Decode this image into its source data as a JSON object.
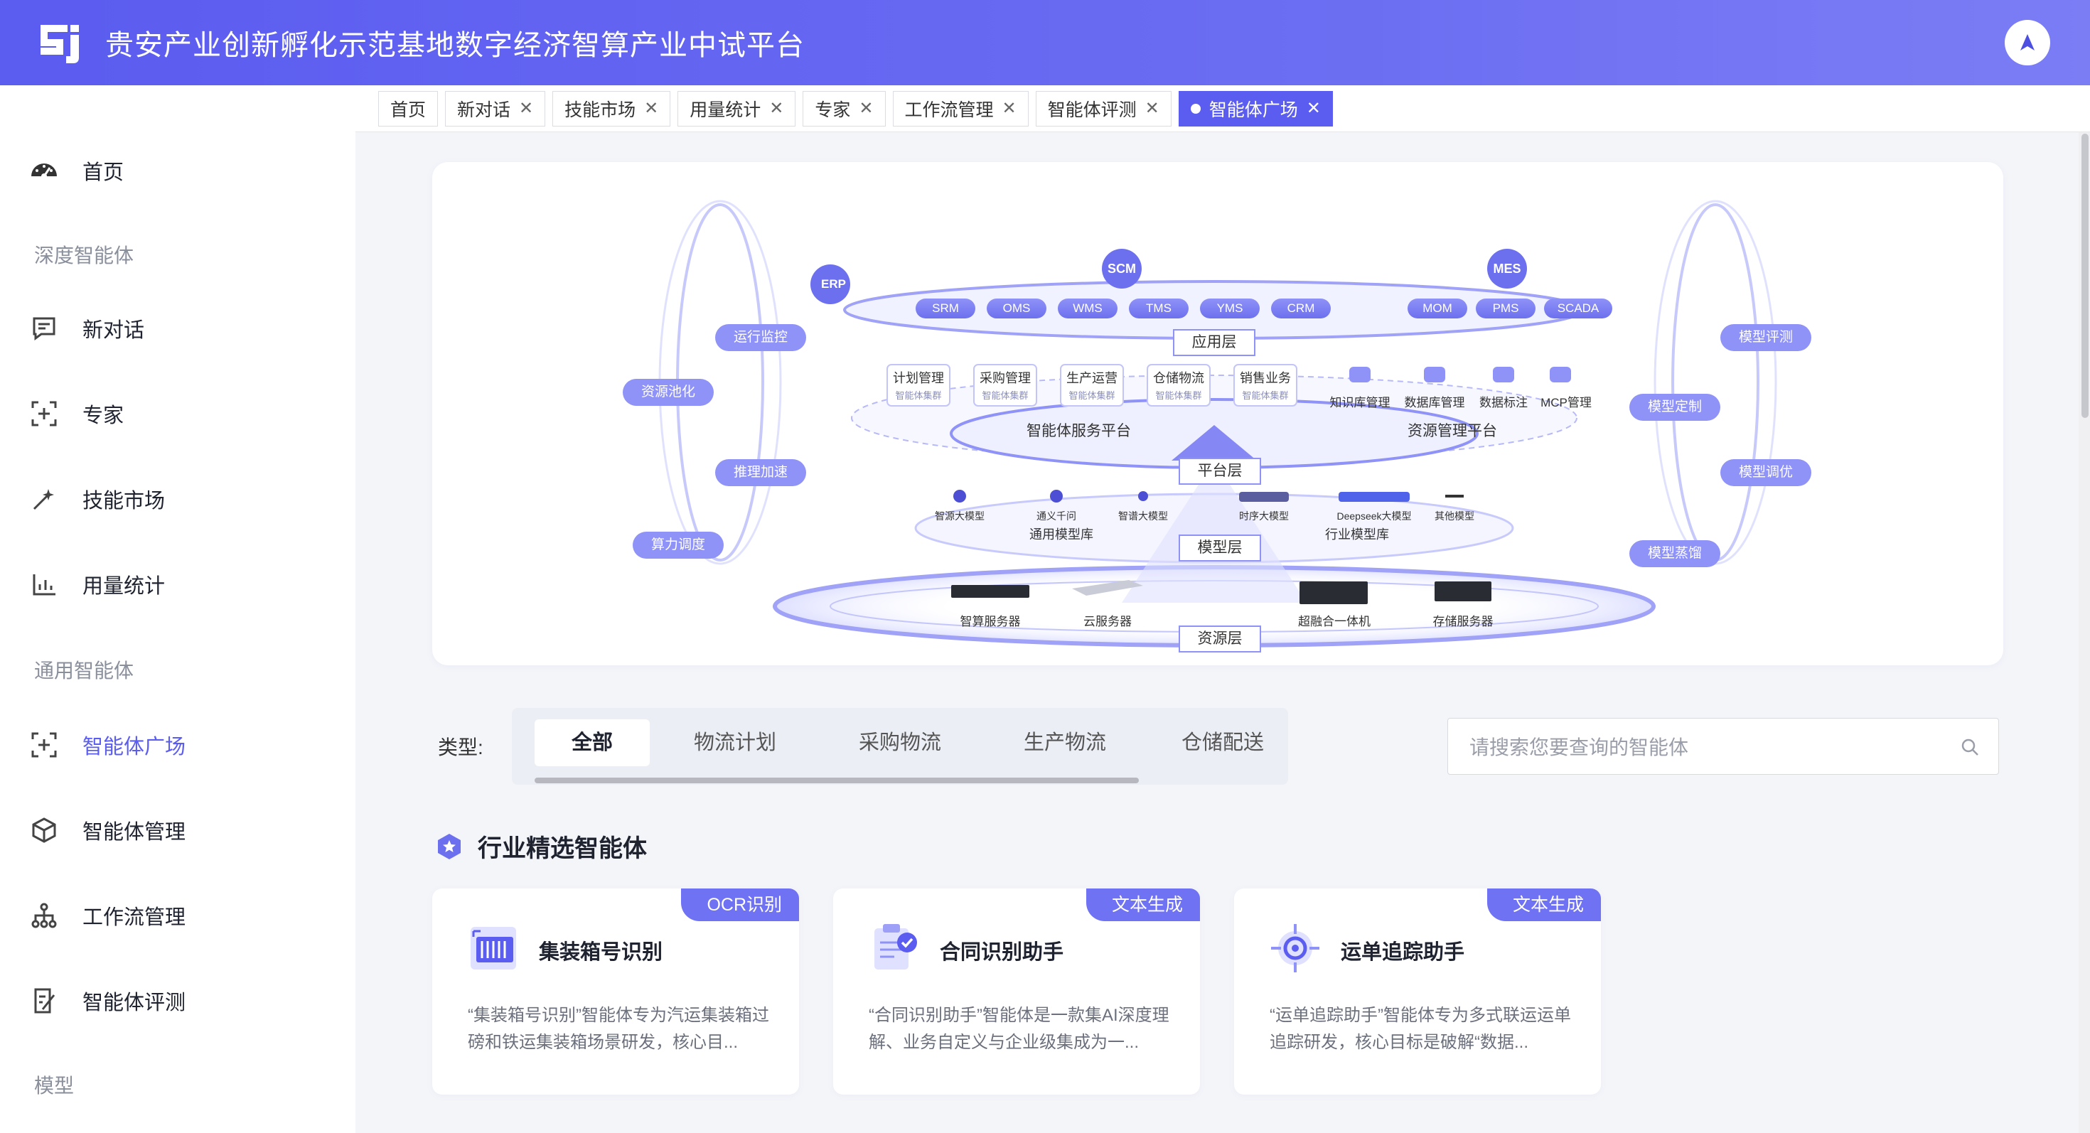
{
  "app": {
    "title": "贵安产业创新孵化示范基地数字经济智算产业中试平台"
  },
  "colors": {
    "brand": "#5b5cf0",
    "badge": "#7072f4"
  },
  "sidebar": {
    "items": [
      {
        "label": "首页",
        "icon": "dashboard-icon"
      },
      {
        "group": "深度智能体"
      },
      {
        "label": "新对话",
        "icon": "chat-icon"
      },
      {
        "label": "专家",
        "icon": "expert-icon"
      },
      {
        "label": "技能市场",
        "icon": "magic-wand-icon"
      },
      {
        "label": "用量统计",
        "icon": "bar-chart-icon"
      },
      {
        "group": "通用智能体"
      },
      {
        "label": "智能体广场",
        "icon": "agent-square-icon",
        "active": true
      },
      {
        "label": "智能体管理",
        "icon": "cube-icon"
      },
      {
        "label": "工作流管理",
        "icon": "workflow-icon"
      },
      {
        "label": "智能体评测",
        "icon": "evaluate-icon"
      },
      {
        "group": "模型"
      }
    ]
  },
  "tabs": [
    {
      "label": "首页",
      "closable": false
    },
    {
      "label": "新对话",
      "closable": true
    },
    {
      "label": "技能市场",
      "closable": true
    },
    {
      "label": "用量统计",
      "closable": true
    },
    {
      "label": "专家",
      "closable": true
    },
    {
      "label": "工作流管理",
      "closable": true
    },
    {
      "label": "智能体评测",
      "closable": true
    },
    {
      "label": "智能体广场",
      "closable": true,
      "active": true
    }
  ],
  "banner": {
    "center_tags": [
      "ERP",
      "SCM",
      "MES"
    ],
    "top_apps_left": [
      "SRM",
      "OMS",
      "WMS",
      "TMS",
      "YMS",
      "CRM"
    ],
    "top_apps_right": [
      "MOM",
      "PMS",
      "SCADA"
    ],
    "layers": [
      "应用层",
      "平台层",
      "模型层",
      "资源层"
    ],
    "left_ops": [
      "运行监控",
      "资源池化",
      "推理加速",
      "算力调度"
    ],
    "right_ops": [
      "模型评测",
      "模型定制",
      "模型调优",
      "模型蒸馏"
    ],
    "platform_boxes": [
      {
        "title": "计划管理",
        "sub": "智能体集群"
      },
      {
        "title": "采购管理",
        "sub": "智能体集群"
      },
      {
        "title": "生产运营",
        "sub": "智能体集群"
      },
      {
        "title": "仓储物流",
        "sub": "智能体集群"
      },
      {
        "title": "销售业务",
        "sub": "智能体集群"
      }
    ],
    "resource_mgmt": [
      "知识库管理",
      "数据库管理",
      "数据标注",
      "MCP管理"
    ],
    "platform_names": [
      "智能体服务平台",
      "资源管理平台"
    ],
    "models": [
      "智源大模型",
      "通义千问",
      "智谱大模型",
      "时序大模型",
      "Deepseek大模型",
      "其他模型"
    ],
    "model_groups": [
      "通用模型库",
      "行业模型库"
    ],
    "servers": [
      "智算服务器",
      "云服务器",
      "超融合一体机",
      "存储服务器"
    ]
  },
  "filter": {
    "label": "类型:",
    "chips": [
      "全部",
      "物流计划",
      "采购物流",
      "生产物流",
      "仓储配送"
    ],
    "active": 0
  },
  "search": {
    "placeholder": "请搜索您要查询的智能体"
  },
  "section": {
    "title": "行业精选智能体"
  },
  "cards": [
    {
      "badge": "OCR识别",
      "title": "集装箱号识别",
      "icon": "container-scan-icon",
      "desc": "“集装箱号识别”智能体专为汽运集装箱过磅和铁运集装箱场景研发，核心目..."
    },
    {
      "badge": "文本生成",
      "title": "合同识别助手",
      "icon": "contract-icon",
      "desc": "“合同识别助手”智能体是一款集AI深度理解、业务自定义与企业级集成为一..."
    },
    {
      "badge": "文本生成",
      "title": "运单追踪助手",
      "icon": "location-target-icon",
      "desc": "“运单追踪助手”智能体专为多式联运运单追踪研发，核心目标是破解“数据..."
    }
  ]
}
